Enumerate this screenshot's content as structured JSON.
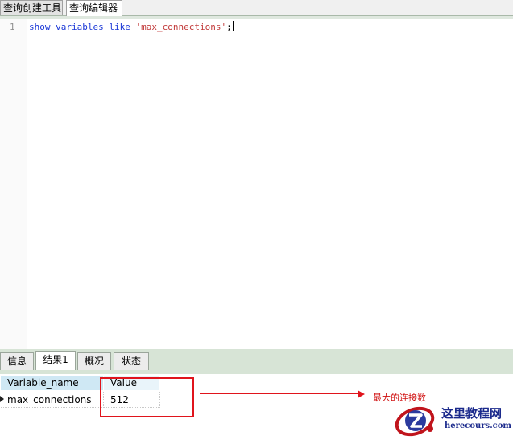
{
  "editor_tabs": [
    {
      "label": "查询创建工具",
      "active": false
    },
    {
      "label": "查询编辑器",
      "active": true
    }
  ],
  "editor": {
    "line_number": "1",
    "code": {
      "kw_show": "show",
      "kw_variables": "variables",
      "kw_like": "like",
      "string_literal": "'max_connections'",
      "terminator": ";"
    }
  },
  "result_tabs": [
    {
      "label": "信息",
      "active": false
    },
    {
      "label": "结果1",
      "active": true
    },
    {
      "label": "概况",
      "active": false
    },
    {
      "label": "状态",
      "active": false
    }
  ],
  "result_grid": {
    "columns": [
      "Variable_name",
      "Value"
    ],
    "rows": [
      [
        "max_connections",
        "512"
      ]
    ]
  },
  "annotation": {
    "text": "最大的连接数",
    "color": "#e0141c"
  },
  "watermark": {
    "title": "这里教程网",
    "subtitle": "herecours.com",
    "color": "#1b2a8c"
  }
}
